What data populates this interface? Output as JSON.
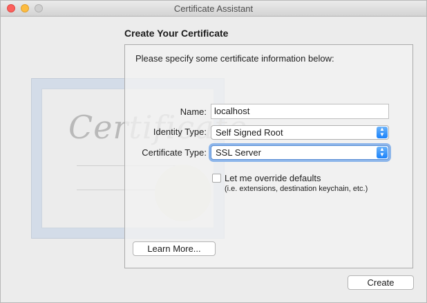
{
  "window": {
    "title": "Certificate Assistant"
  },
  "decor": {
    "certificate_word": "Certificate"
  },
  "heading": "Create Your Certificate",
  "panel": {
    "intro": "Please specify some certificate information below:",
    "name": {
      "label": "Name:",
      "value": "localhost"
    },
    "identity_type": {
      "label": "Identity Type:",
      "value": "Self Signed Root"
    },
    "certificate_type": {
      "label": "Certificate Type:",
      "value": "SSL Server"
    },
    "override": {
      "label": "Let me override defaults",
      "hint": "(i.e. extensions, destination keychain, etc.)",
      "checked": false
    },
    "learn_more": "Learn More..."
  },
  "footer": {
    "create": "Create"
  },
  "colors": {
    "accent": "#1a82fb",
    "focus_ring": "#8cb5ea"
  }
}
